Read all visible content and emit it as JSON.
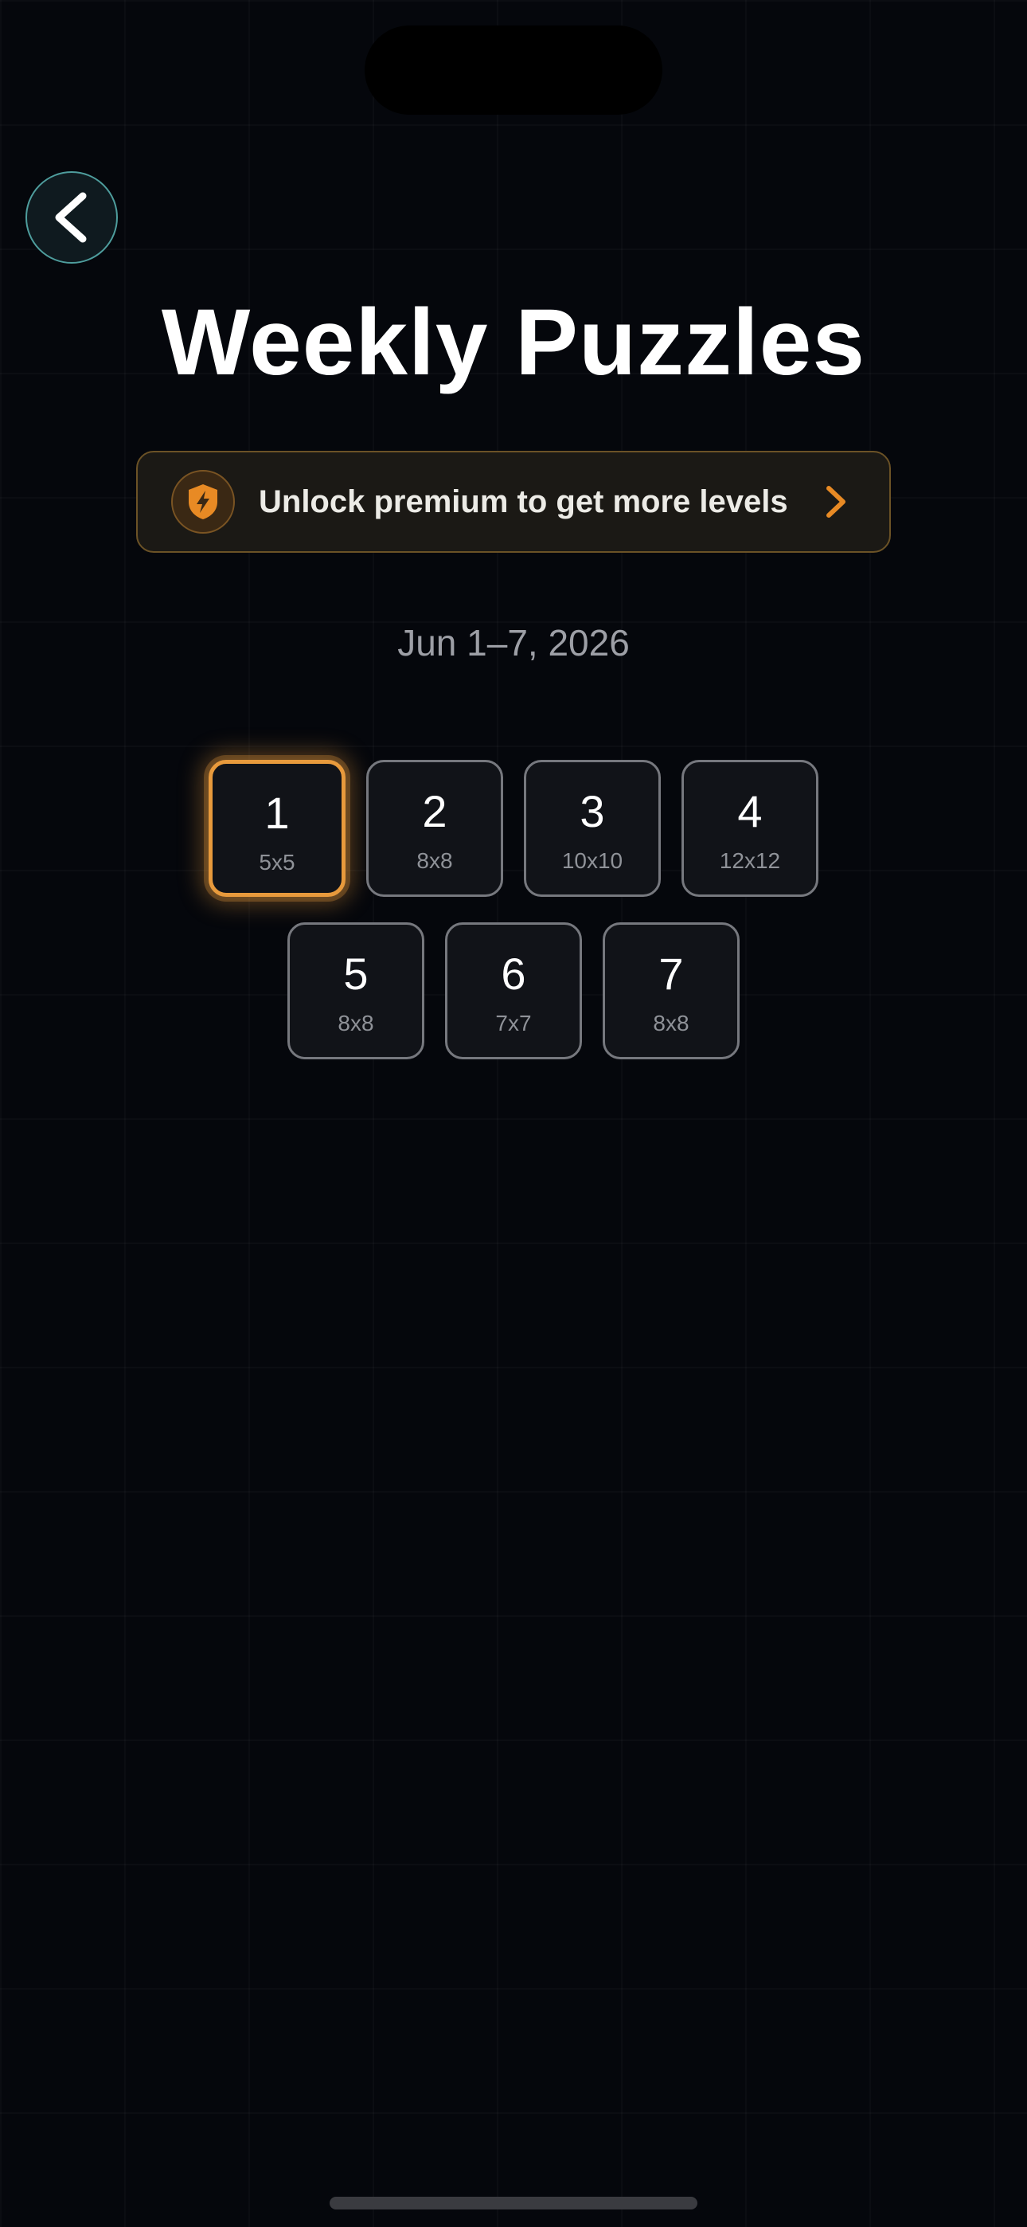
{
  "header": {
    "title": "Weekly Puzzles",
    "back_icon": "chevron-left-icon"
  },
  "premium_banner": {
    "text": "Unlock premium to get more levels",
    "icon": "lightning-shield-icon",
    "chevron_icon": "chevron-right-icon",
    "accent_color": "#e88a24"
  },
  "date_range": "Jun 1–7, 2026",
  "levels": [
    {
      "number": "1",
      "size": "5x5",
      "selected": true
    },
    {
      "number": "2",
      "size": "8x8",
      "selected": false
    },
    {
      "number": "3",
      "size": "10x10",
      "selected": false
    },
    {
      "number": "4",
      "size": "12x12",
      "selected": false
    },
    {
      "number": "5",
      "size": "8x8",
      "selected": false
    },
    {
      "number": "6",
      "size": "7x7",
      "selected": false
    },
    {
      "number": "7",
      "size": "8x8",
      "selected": false
    }
  ],
  "colors": {
    "background": "#05070c",
    "selected_accent": "#e89a3c",
    "back_button_ring": "#4e9d9d"
  }
}
